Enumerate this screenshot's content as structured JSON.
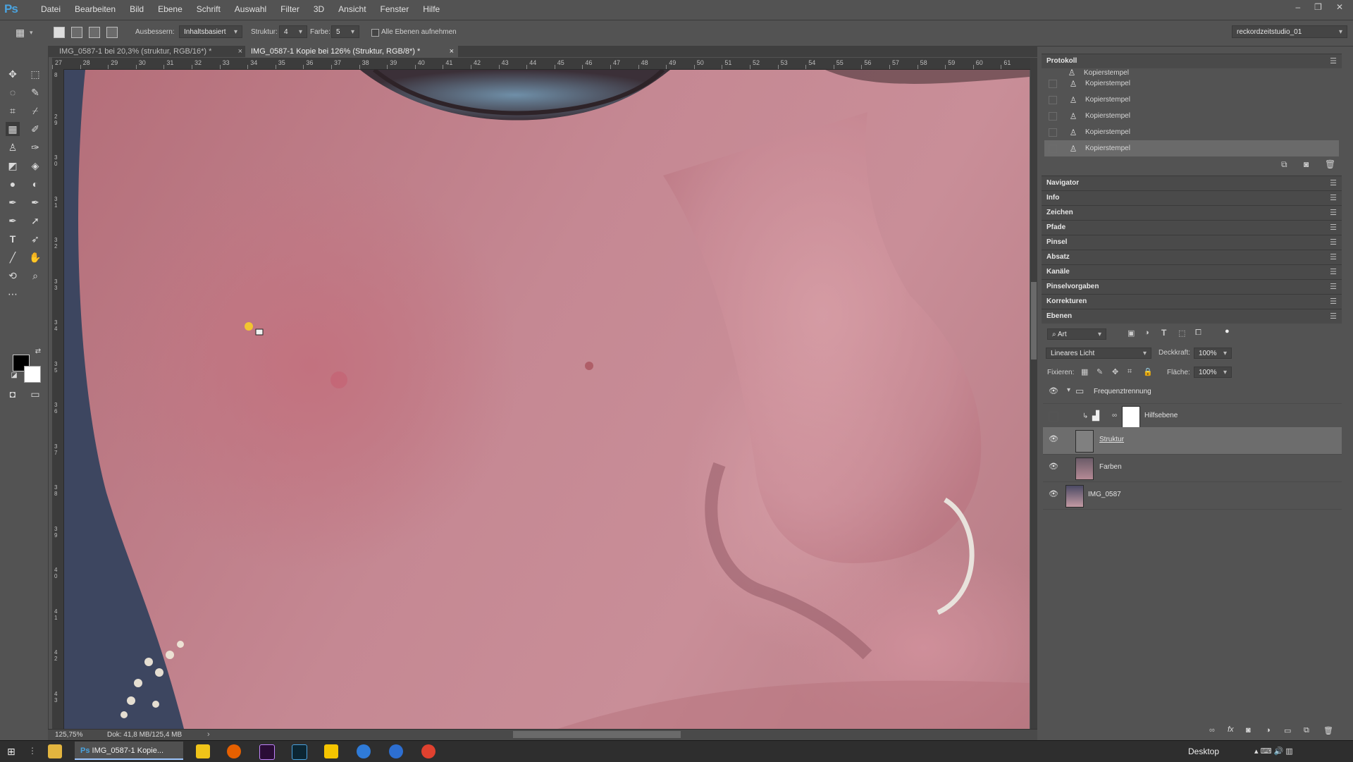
{
  "app": {
    "logo": "Ps"
  },
  "menu": [
    "Datei",
    "Bearbeiten",
    "Bild",
    "Ebene",
    "Schrift",
    "Auswahl",
    "Filter",
    "3D",
    "Ansicht",
    "Fenster",
    "Hilfe"
  ],
  "options": {
    "ausbessern_label": "Ausbessern:",
    "ausbessern_value": "Inhaltsbasiert",
    "struktur_label": "Struktur:",
    "struktur_value": "4",
    "farbe_label": "Farbe:",
    "farbe_value": "5",
    "alle_ebenen": "Alle Ebenen aufnehmen",
    "workspace": "reckordzeitstudio_01"
  },
  "tabs": [
    {
      "label": "IMG_0587-1 bei 20,3% (struktur, RGB/16*) *"
    },
    {
      "label": "IMG_0587-1 Kopie bei 126% (Struktur, RGB/8*) *"
    }
  ],
  "ruler": {
    "top": [
      "27",
      "28",
      "29",
      "30",
      "31",
      "32",
      "33",
      "34",
      "35",
      "36",
      "37",
      "38",
      "39",
      "40",
      "41",
      "42",
      "43",
      "44",
      "45",
      "46",
      "47",
      "48",
      "49",
      "50",
      "51",
      "52",
      "53",
      "54",
      "55",
      "56",
      "57",
      "58",
      "59",
      "60",
      "61"
    ],
    "left": [
      "8",
      "2 9",
      "3 0",
      "3 1",
      "3 2",
      "3 3",
      "3 4",
      "3 5",
      "3 6",
      "3 7",
      "3 8",
      "3 9",
      "4 0",
      "4 1",
      "4 2",
      "4 3"
    ]
  },
  "status": {
    "zoom": "125,75%",
    "doc": "Dok: 41,8 MB/125,4 MB"
  },
  "history": {
    "title": "Protokoll",
    "items": [
      {
        "label": "Kopierstempel"
      },
      {
        "label": "Kopierstempel"
      },
      {
        "label": "Kopierstempel"
      },
      {
        "label": "Kopierstempel"
      },
      {
        "label": "Kopierstempel"
      },
      {
        "label": "Kopierstempel"
      }
    ]
  },
  "collapsed_panels": [
    "Navigator",
    "Info",
    "Zeichen",
    "Pfade",
    "Pinsel",
    "Absatz",
    "Kanäle",
    "Pinselvorgaben",
    "Korrekturen",
    "Ebenen"
  ],
  "layers": {
    "filter_label": "Art",
    "blend_mode": "Lineares Licht",
    "opacity_label": "Deckkraft:",
    "opacity_value": "100%",
    "lock_label": "Fixieren:",
    "fill_label": "Fläche:",
    "fill_value": "100%",
    "group_name": "Frequenztrennung",
    "items": [
      {
        "name": "Hilfsebene"
      },
      {
        "name": "Struktur"
      },
      {
        "name": "Farben"
      },
      {
        "name": "IMG_0587"
      }
    ]
  },
  "taskbar": {
    "active_window": "IMG_0587-1 Kopie...",
    "desktop_label": "Desktop"
  },
  "colors": {
    "accent": "#4aa3df",
    "skin": "#c58893",
    "panel": "#535353"
  }
}
